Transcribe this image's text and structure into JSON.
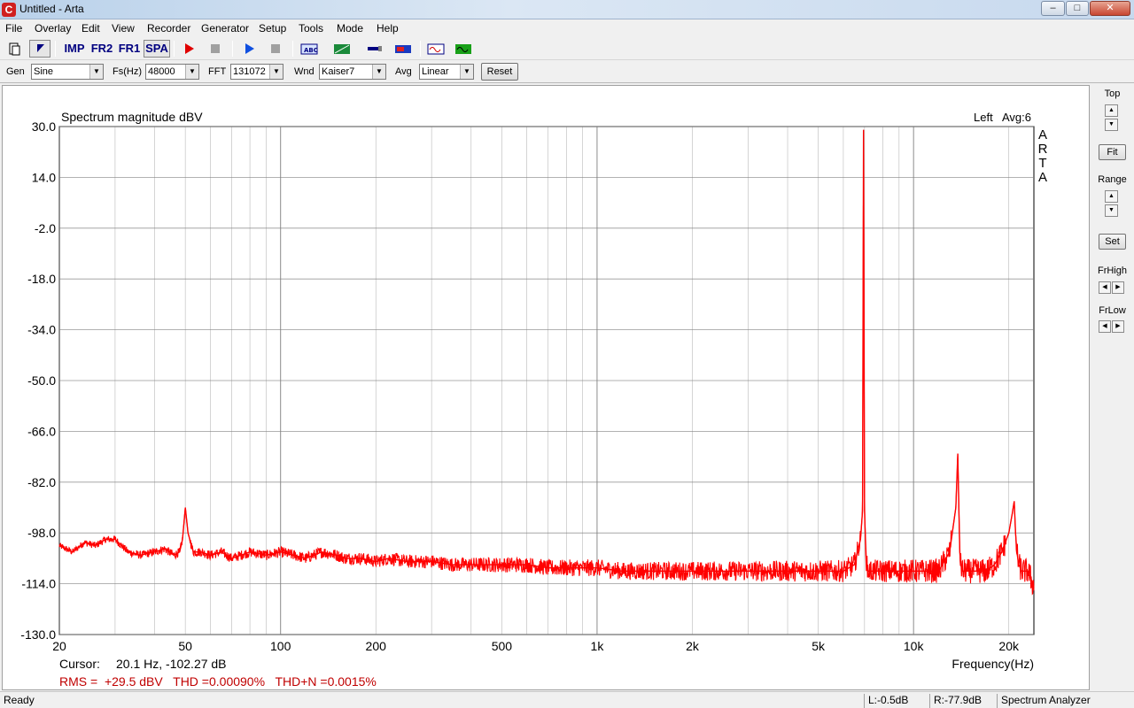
{
  "window": {
    "title": "Untitled - Arta",
    "app_icon": "arta-logo-icon"
  },
  "menu": [
    "File",
    "Overlay",
    "Edit",
    "View",
    "Recorder",
    "Generator",
    "Setup",
    "Tools",
    "Mode",
    "Help"
  ],
  "toolbar": {
    "imp": "IMP",
    "fr2": "FR2",
    "fr1": "FR1",
    "spa": "SPA"
  },
  "controls": {
    "gen_label": "Gen",
    "gen_value": "Sine",
    "fs_label": "Fs(Hz)",
    "fs_value": "48000",
    "fft_label": "FFT",
    "fft_value": "131072",
    "wnd_label": "Wnd",
    "wnd_value": "Kaiser7",
    "avg_label": "Avg",
    "avg_value": "Linear",
    "reset": "Reset"
  },
  "plot": {
    "channel": "Left",
    "avg": "Avg:6",
    "watermark": "ARTA",
    "cursor_label": "Cursor:",
    "cursor_value": "20.1 Hz, -102.27 dB",
    "stats": "RMS =  +29.5 dBV   THD =0.00090%   THD+N =0.0015%",
    "colors": {
      "trace": "#ff0000",
      "grid": "#808080",
      "stats": "#c00000"
    }
  },
  "side_panel": {
    "top": "Top",
    "fit": "Fit",
    "range": "Range",
    "set": "Set",
    "frhigh": "FrHigh",
    "frlow": "FrLow"
  },
  "status": {
    "ready": "Ready",
    "left_level": "L:-0.5dB",
    "right_level": "R:-77.9dB",
    "mode": "Spectrum Analyzer"
  },
  "chart_data": {
    "type": "line",
    "title": "Spectrum magnitude dBV",
    "xlabel": "Frequency(Hz)",
    "ylabel": "",
    "xscale": "log",
    "xlim": [
      20,
      24000
    ],
    "ylim": [
      -130,
      30
    ],
    "yticks": [
      "30.0",
      "14.0",
      "-2.0",
      "-18.0",
      "-34.0",
      "-50.0",
      "-66.0",
      "-82.0",
      "-98.0",
      "-114.0",
      "-130.0"
    ],
    "xticks": [
      {
        "f": 20,
        "label": "20"
      },
      {
        "f": 50,
        "label": "50"
      },
      {
        "f": 100,
        "label": "100"
      },
      {
        "f": 200,
        "label": "200"
      },
      {
        "f": 500,
        "label": "500"
      },
      {
        "f": 1000,
        "label": "1k"
      },
      {
        "f": 2000,
        "label": "2k"
      },
      {
        "f": 5000,
        "label": "5k"
      },
      {
        "f": 10000,
        "label": "10k"
      },
      {
        "f": 20000,
        "label": "20k"
      }
    ],
    "grid": true,
    "series": [
      {
        "x": [
          20,
          22,
          24,
          26,
          28,
          30,
          33,
          36,
          40,
          43,
          46,
          48,
          49,
          50,
          51,
          53,
          56,
          60,
          65,
          70,
          75,
          80,
          90,
          100,
          110,
          120,
          135,
          150,
          160,
          180,
          200,
          220,
          250,
          300,
          350,
          400,
          500,
          600,
          700,
          800,
          1000,
          1200,
          1500,
          2000,
          2500,
          3000,
          3500,
          4000,
          4500,
          5000,
          5500,
          6000,
          6500,
          6800,
          6900,
          6950,
          7000,
          7050,
          7100,
          7200,
          7500,
          8000,
          9000,
          10000,
          11000,
          12000,
          13000,
          13600,
          13800,
          13900,
          14000,
          14100,
          14300,
          15000,
          16000,
          17000,
          18000,
          19000,
          20000,
          20500,
          20800,
          21000,
          21200,
          21500,
          22000,
          23000,
          24000
        ],
        "y": [
          -102,
          -104,
          -101,
          -102,
          -100,
          -100,
          -104,
          -105,
          -104,
          -103,
          -105,
          -104,
          -100,
          -90,
          -98,
          -104,
          -104,
          -105,
          -104,
          -106,
          -105,
          -104,
          -105,
          -104,
          -105,
          -106,
          -104,
          -105,
          -106,
          -106,
          -107,
          -106,
          -107,
          -107,
          -108,
          -108,
          -108,
          -108,
          -109,
          -109,
          -109,
          -110,
          -110,
          -110,
          -110,
          -110,
          -110,
          -110,
          -110,
          -110,
          -110,
          -110,
          -108,
          -100,
          -91,
          29,
          -91,
          -100,
          -108,
          -110,
          -110,
          -110,
          -110,
          -110,
          -110,
          -110,
          -104,
          -90,
          -73,
          -90,
          -104,
          -108,
          -110,
          -110,
          -110,
          -110,
          -108,
          -104,
          -98,
          -92,
          -88,
          -98,
          -104,
          -108,
          -110,
          -110,
          -115
        ]
      }
    ]
  }
}
